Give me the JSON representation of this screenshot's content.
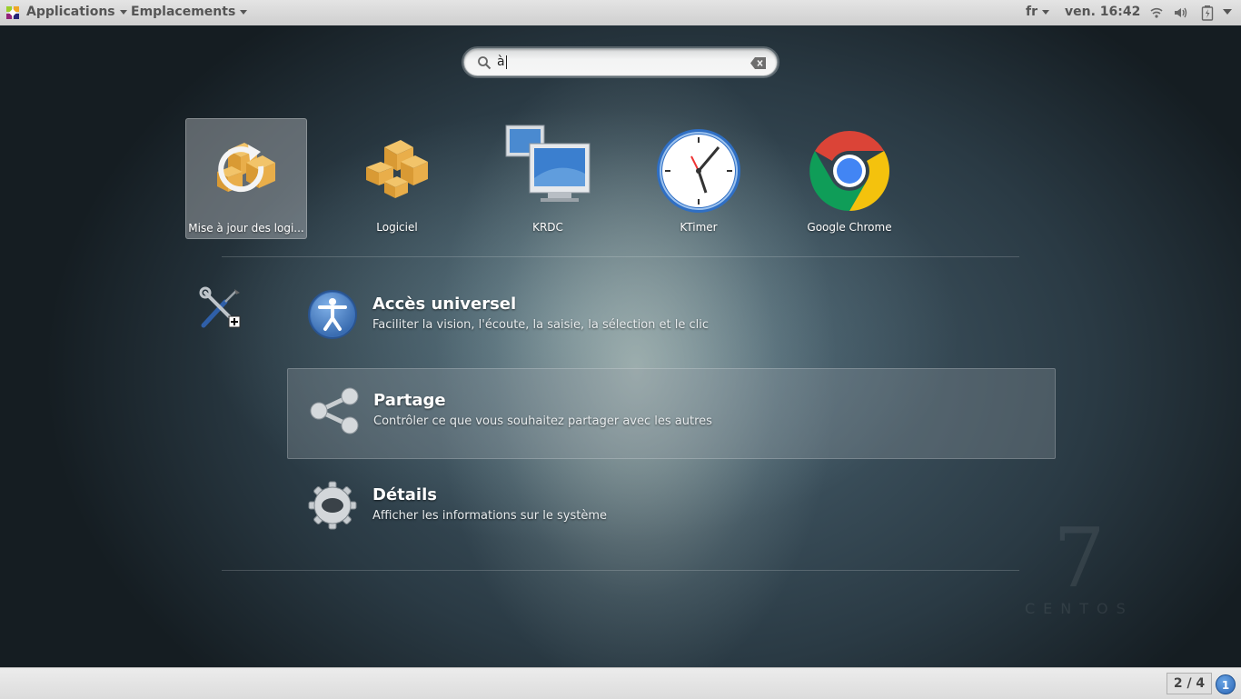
{
  "topbar": {
    "applications": "Applications",
    "places": "Emplacements",
    "language": "fr",
    "clock": "ven. 16:42"
  },
  "search": {
    "value": "à"
  },
  "apps": [
    {
      "label": "Mise à jour des logi...",
      "icon": "software-update-icon",
      "selected": true
    },
    {
      "label": "Logiciel",
      "icon": "software-packages-icon",
      "selected": false
    },
    {
      "label": "KRDC",
      "icon": "remote-desktop-icon",
      "selected": false
    },
    {
      "label": "KTimer",
      "icon": "clock-icon",
      "selected": false
    },
    {
      "label": "Google Chrome",
      "icon": "chrome-icon",
      "selected": false
    }
  ],
  "settings": {
    "icon": "tools-icon",
    "results": [
      {
        "title": "Accès universel",
        "desc": "Faciliter la vision, l'écoute, la saisie, la sélection et le clic",
        "icon": "accessibility-icon"
      },
      {
        "title": "Partage",
        "desc": "Contrôler ce que vous souhaitez partager avec les autres",
        "icon": "share-icon",
        "selected": true
      },
      {
        "title": "Détails",
        "desc": "Afficher les informations sur le système",
        "icon": "gear-icon"
      }
    ]
  },
  "watermark": {
    "number": "7",
    "word": "CENTOS"
  },
  "bottombar": {
    "workspace": "2 / 4",
    "notifications": "1"
  }
}
